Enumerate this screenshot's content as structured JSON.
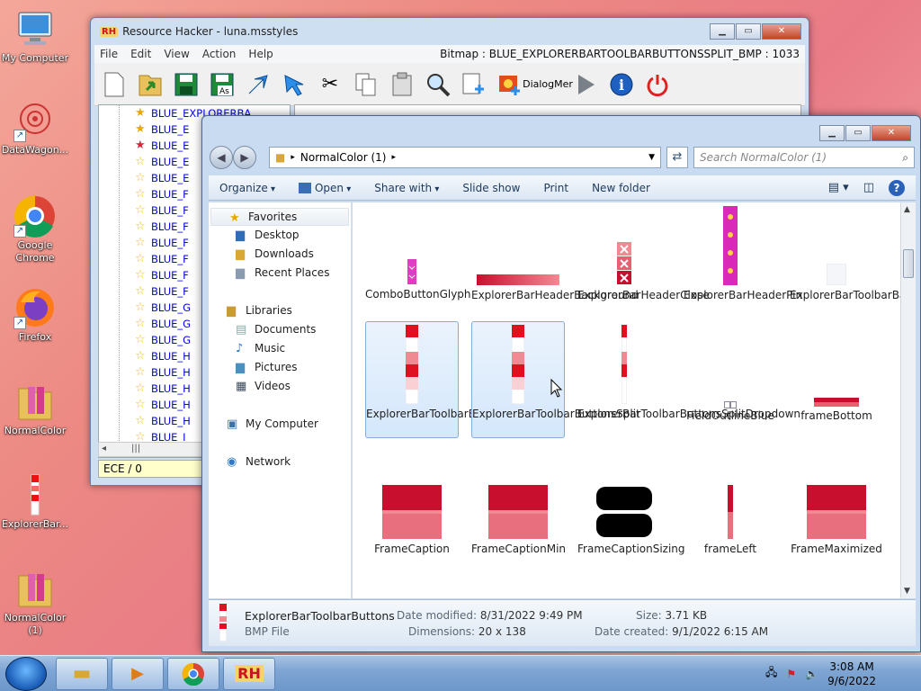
{
  "desktop": {
    "icons": [
      {
        "label": "My Computer",
        "icon": "computer-icon"
      },
      {
        "label": "DataWagon...",
        "icon": "flower-icon"
      },
      {
        "label": "Google Chrome",
        "icon": "chrome-icon"
      },
      {
        "label": "Firefox",
        "icon": "firefox-icon"
      },
      {
        "label": "NormalColor",
        "icon": "folder-icon"
      },
      {
        "label": "ExplorerBar...",
        "icon": "bitmap-icon"
      },
      {
        "label": "NormalColor (1)",
        "icon": "folder-icon"
      }
    ]
  },
  "rh": {
    "title": "Resource Hacker - luna.msstyles",
    "menu": [
      "File",
      "Edit",
      "View",
      "Action",
      "Help"
    ],
    "info": "Bitmap : BLUE_EXPLORERBARTOOLBARBUTTONSSPLIT_BMP : 1033",
    "toolbar_text": {
      "dialog": "Dialog",
      "merge": "Mer"
    },
    "tree": [
      "BLUE_EXPLORERBA",
      "BLUE_E",
      "BLUE_E",
      "BLUE_E",
      "BLUE_E",
      "BLUE_F",
      "BLUE_F",
      "BLUE_F",
      "BLUE_F",
      "BLUE_F",
      "BLUE_F",
      "BLUE_F",
      "BLUE_G",
      "BLUE_G",
      "BLUE_G",
      "BLUE_H",
      "BLUE_H",
      "BLUE_H",
      "BLUE_H",
      "BLUE_H",
      "BLUE_I"
    ],
    "status": "ECE / 0",
    "hscroll": "|||"
  },
  "ex": {
    "breadcrumb": "NormalColor (1)",
    "search_placeholder": "Search NormalColor (1)",
    "commands": {
      "organize": "Organize",
      "open": "Open",
      "share": "Share with",
      "slideshow": "Slide show",
      "print": "Print",
      "newfolder": "New folder"
    },
    "nav": {
      "favorites": "Favorites",
      "desktop": "Desktop",
      "downloads": "Downloads",
      "recent": "Recent Places",
      "libraries": "Libraries",
      "documents": "Documents",
      "music": "Music",
      "pictures": "Pictures",
      "videos": "Videos",
      "computer": "My Computer",
      "network": "Network"
    },
    "files": [
      "ComboButtonGlyph",
      "ExplorerBarHeaderBackground",
      "ExplorerBarHeaderClose",
      "ExplorerBarHeaderPin",
      "ExplorerBarToolbarBackground",
      "ExplorerBarToolbarButtons",
      "ExplorerBarToolbarButtonsSplit",
      "ExplorerBarToolbarButtonsSplitDropdown",
      "FieldOutlineBlue",
      "frameBottom",
      "FrameCaption",
      "FrameCaptionMin",
      "FrameCaptionSizing",
      "frameLeft",
      "FrameMaximized"
    ],
    "details": {
      "name": "ExplorerBarToolbarButtons",
      "type": "BMP File",
      "modified_label": "Date modified:",
      "modified": "8/31/2022 9:49 PM",
      "dimensions_label": "Dimensions:",
      "dimensions": "20 x 138",
      "size_label": "Size:",
      "size": "3.71 KB",
      "created_label": "Date created:",
      "created": "9/1/2022 6:15 AM"
    }
  },
  "taskbar": {
    "time": "3:08 AM",
    "date": "9/6/2022",
    "rh_label": "RH"
  },
  "colors": {
    "accent_red": "#d81e2e",
    "selection": "#d5e7fb",
    "taskbar": "#7fa6d4"
  }
}
